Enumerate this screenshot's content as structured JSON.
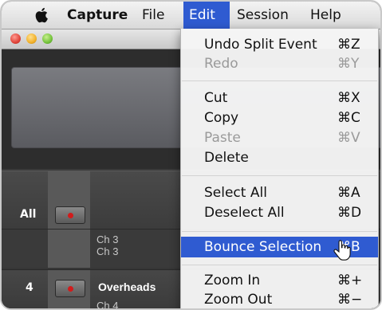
{
  "menubar": {
    "app": "Capture",
    "items": [
      "File",
      "Edit",
      "Session",
      "Help"
    ]
  },
  "track_area": {
    "all_label": "All",
    "track_number": "4",
    "track_name": "Overheads",
    "sub_channels": [
      "Ch 3",
      "Ch 3",
      "Ch 4"
    ]
  },
  "edit_menu": {
    "items": [
      {
        "label": "Undo Split Event",
        "shortcut": "⌘Z"
      },
      {
        "label": "Redo",
        "shortcut": "⌘Y"
      },
      {
        "label": "Cut",
        "shortcut": "⌘X"
      },
      {
        "label": "Copy",
        "shortcut": "⌘C"
      },
      {
        "label": "Paste",
        "shortcut": "⌘V"
      },
      {
        "label": "Delete",
        "shortcut": ""
      },
      {
        "label": "Select All",
        "shortcut": "⌘A"
      },
      {
        "label": "Deselect All",
        "shortcut": "⌘D"
      },
      {
        "label": "Bounce Selection",
        "shortcut": "⌘B"
      },
      {
        "label": "Zoom In",
        "shortcut": "⌘+"
      },
      {
        "label": "Zoom Out",
        "shortcut": "⌘−"
      }
    ],
    "disabled": [
      "Redo",
      "Paste"
    ],
    "highlighted": "Bounce Selection"
  },
  "colors": {
    "highlight": "#2f5bd1",
    "record_dot": "#d21b1b"
  }
}
